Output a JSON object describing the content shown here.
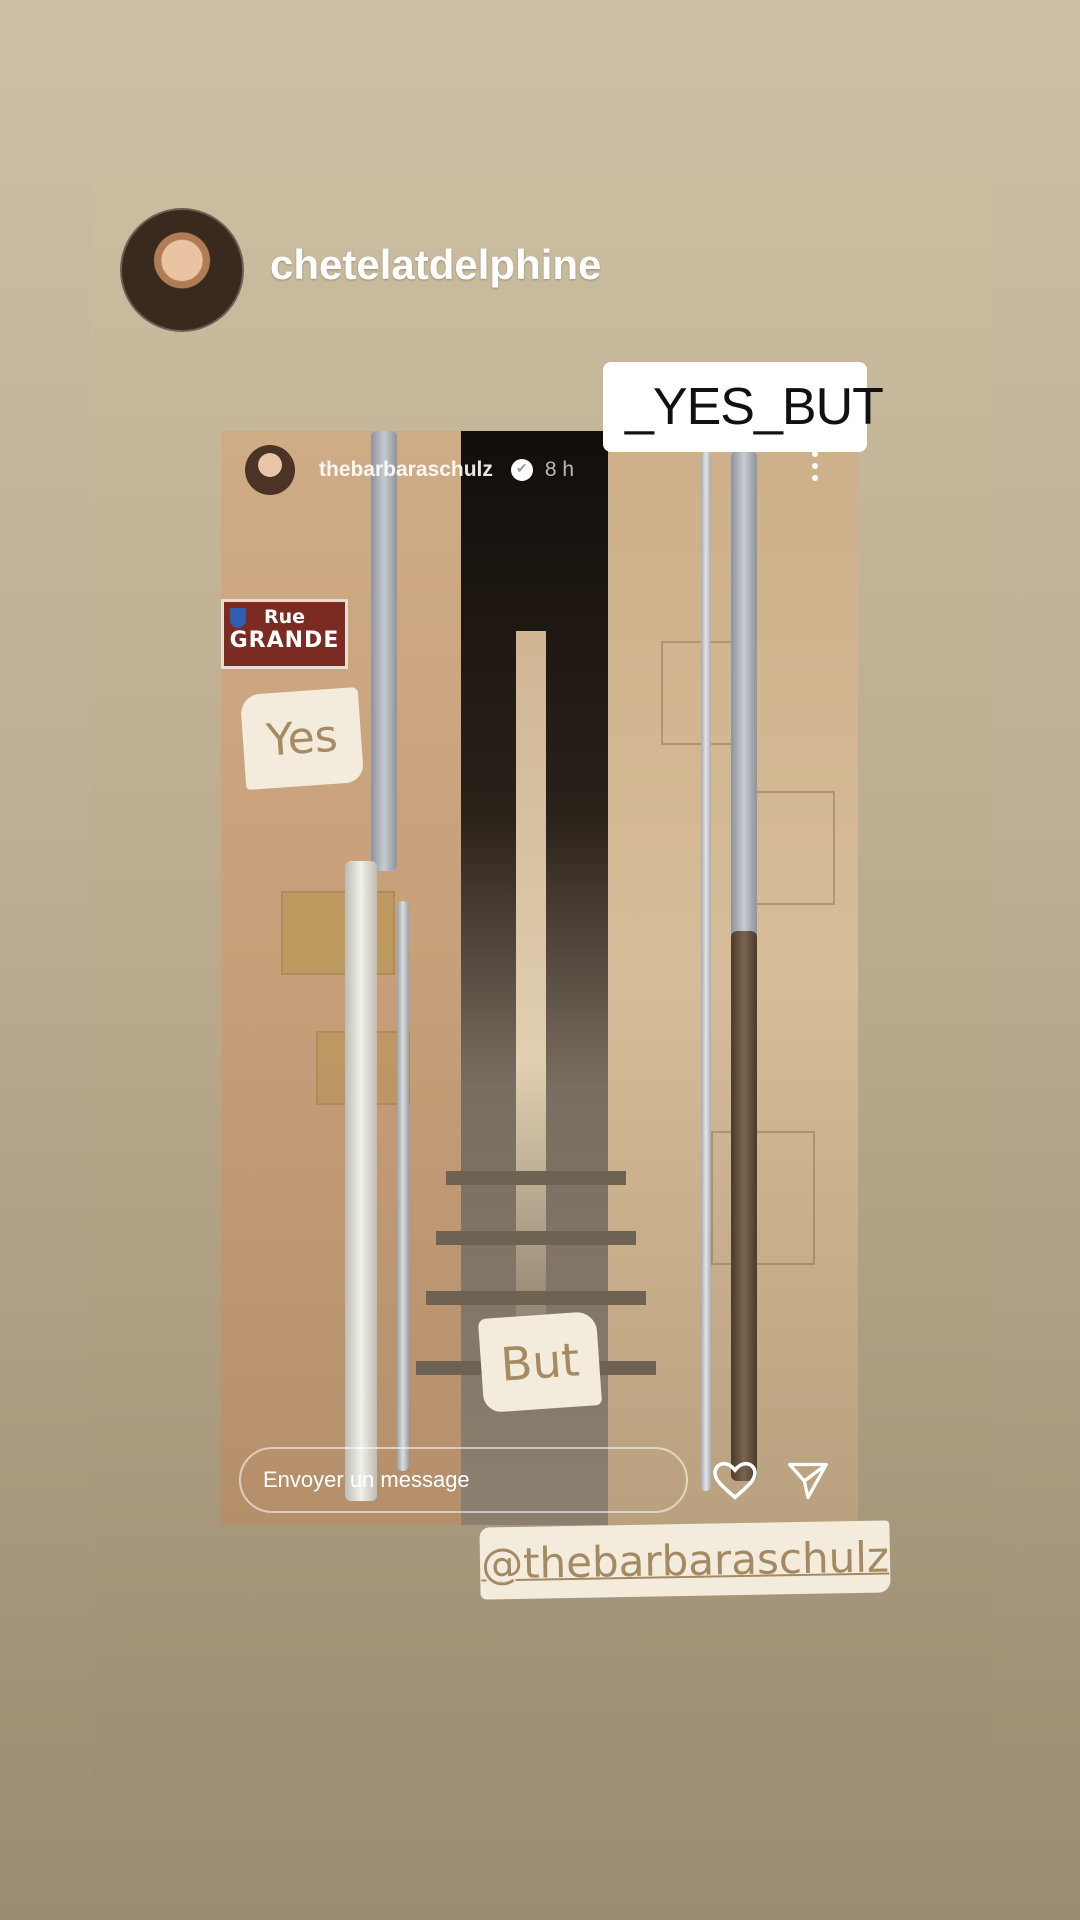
{
  "story": {
    "owner_name": "chetelatdelphine",
    "tag_sticker_text": "_YES_BUT",
    "tag_sticker_icon": "threads-icon"
  },
  "shared_post": {
    "username": "thebarbaraschulz",
    "verified_icon": "verified-badge-icon",
    "time_ago": "8 h",
    "street_sign": {
      "line1": "Rue",
      "line2": "GRANDE"
    },
    "stickers": {
      "top": "Yes",
      "bottom": "But"
    },
    "message_placeholder": "Envoyer un message",
    "actions": [
      "heart-icon",
      "send-icon"
    ]
  },
  "mention_sticker": "@thebarbaraschulz",
  "colors": {
    "background_top": "#cdbfa3",
    "background_bottom": "#9b8b70",
    "sticker_fill": "#f3ecdd",
    "sticker_text": "#a58a62",
    "street_sign_red": "#7b2b21"
  }
}
